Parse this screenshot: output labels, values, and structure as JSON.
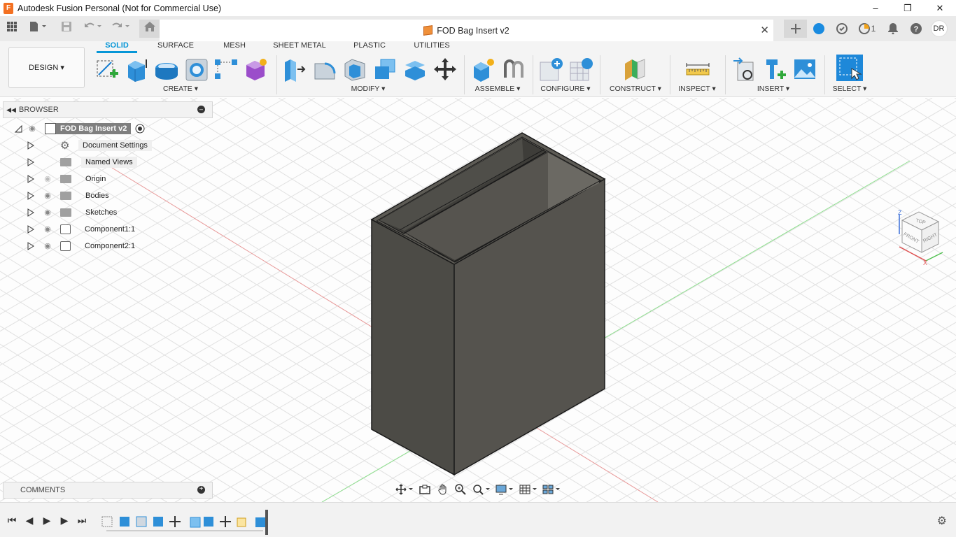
{
  "window": {
    "title": "Autodesk Fusion Personal (Not for Commercial Use)",
    "app_icon": "F",
    "minimize": "–",
    "maximize": "❐",
    "close": "✕"
  },
  "doc_tab": {
    "name": "FOD Bag Insert v2",
    "close": "✕"
  },
  "account": {
    "notification_count": "1",
    "initials": "DR"
  },
  "toolbar": {
    "design_label": "DESIGN ▾",
    "tabs": [
      "SOLID",
      "SURFACE",
      "MESH",
      "SHEET METAL",
      "PLASTIC",
      "UTILITIES"
    ],
    "active_tab": "SOLID",
    "groups": {
      "create": "CREATE ▾",
      "modify": "MODIFY ▾",
      "assemble": "ASSEMBLE ▾",
      "configure": "CONFIGURE ▾",
      "construct": "CONSTRUCT ▾",
      "inspect": "INSPECT ▾",
      "insert": "INSERT ▾",
      "select": "SELECT ▾"
    }
  },
  "browser": {
    "title": "BROWSER",
    "root": "FOD Bag Insert v2",
    "items": [
      {
        "label": "Document Settings",
        "icon": "gear-icon"
      },
      {
        "label": "Named Views",
        "icon": "folder-icon"
      },
      {
        "label": "Origin",
        "icon": "folder-icon"
      },
      {
        "label": "Bodies",
        "icon": "folder-icon"
      },
      {
        "label": "Sketches",
        "icon": "folder-icon"
      },
      {
        "label": "Component1:1",
        "icon": "component-icon"
      },
      {
        "label": "Component2:1",
        "icon": "component-icon"
      }
    ]
  },
  "comments": {
    "title": "COMMENTS"
  },
  "viewcube": {
    "top": "TOP",
    "front": "FRONT",
    "right": "RIGHT",
    "axis_z": "Z",
    "axis_x": "X"
  },
  "colors": {
    "accent": "#0696d7",
    "body_front": "#4b4a45",
    "body_side": "#57554f",
    "grid": "#e2e2e2",
    "axis_red": "#e07a7a",
    "axis_green": "#7ad77a"
  }
}
